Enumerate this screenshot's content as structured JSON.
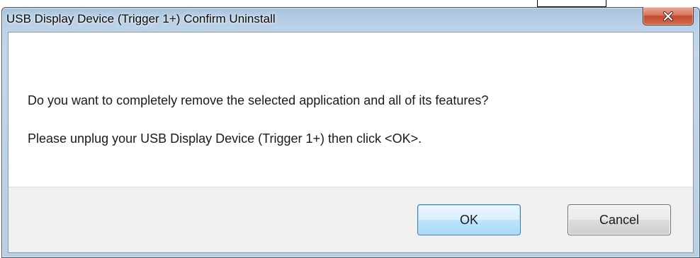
{
  "window": {
    "title": "USB Display Device (Trigger 1+) Confirm Uninstall",
    "close_icon": "close-icon"
  },
  "message": {
    "line1": "Do you want to completely remove the selected application and all of its features?",
    "line2": "Please unplug your USB Display Device (Trigger 1+) then click <OK>."
  },
  "buttons": {
    "ok_label": "OK",
    "cancel_label": "Cancel"
  },
  "colors": {
    "close_button": "#c24a2f",
    "ok_button_border": "#3c7fb1",
    "title_bar": "#bcd2e8"
  }
}
